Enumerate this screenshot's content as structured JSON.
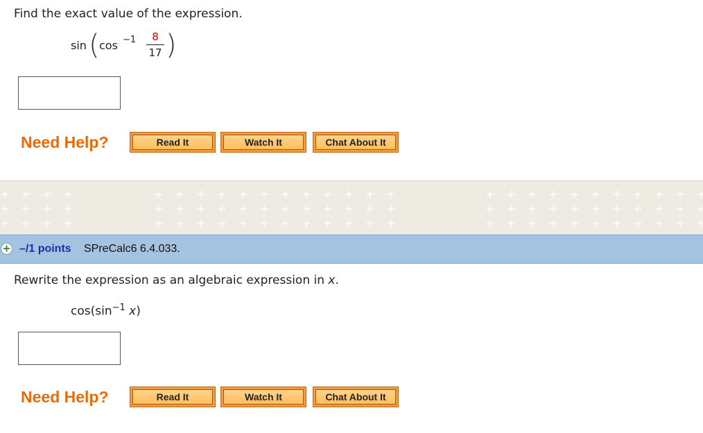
{
  "question1": {
    "prompt": "Find the exact value of the expression.",
    "expression": {
      "outer_func": "sin",
      "inner_func": "cos",
      "exponent": "−1",
      "numerator": "8",
      "denominator": "17"
    },
    "answer_value": ""
  },
  "help1": {
    "label": "Need Help?",
    "read_it": "Read It",
    "watch_it": "Watch It",
    "chat_about_it": "Chat About It"
  },
  "question2_header": {
    "expand_icon": "plus-icon",
    "points": "–/1 points",
    "question_id": "SPreCalc6 6.4.033."
  },
  "question2": {
    "prompt_prefix": "Rewrite the expression as an algebraic expression in ",
    "prompt_var": "x",
    "prompt_suffix": ".",
    "expr_prefix": "cos(sin",
    "expr_exponent": "−1",
    "expr_var": "x",
    "expr_suffix": ")",
    "answer_value": ""
  },
  "help2": {
    "label": "Need Help?",
    "read_it": "Read It",
    "watch_it": "Watch It",
    "chat_about_it": "Chat About It"
  },
  "colors": {
    "need_help": "#e46c0a",
    "button_fill": "#ffc86e",
    "header_bar": "#a3c3e1",
    "points_text": "#1a2fb0",
    "fraction_numerator": "#d00000",
    "separator": "#eeebe3"
  }
}
